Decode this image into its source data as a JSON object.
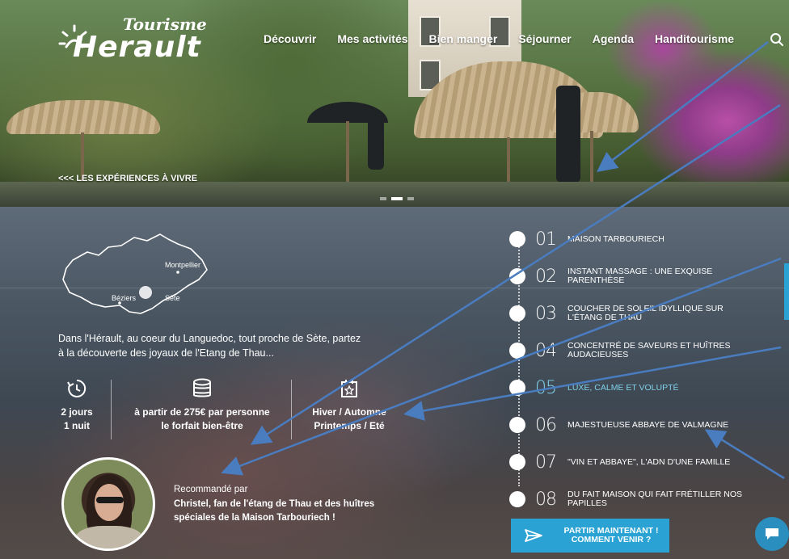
{
  "logo": {
    "line1": "Tourisme",
    "line2": "Herault"
  },
  "nav": {
    "items": [
      "Découvrir",
      "Mes activités",
      "Bien manger",
      "Séjourner",
      "Agenda",
      "Handitourisme"
    ]
  },
  "hero": {
    "back_link": "<<< LES EXPÉRIENCES À VIVRE"
  },
  "map": {
    "cities": [
      "Montpellier",
      "Béziers",
      "Sète"
    ]
  },
  "intro_text": "Dans l'Hérault, au coeur du Languedoc, tout proche de Sète, partez à la découverte des joyaux de l'Etang de Thau...",
  "facts": [
    {
      "icon": "clock-icon",
      "line1": "2 jours",
      "line2": "1 nuit"
    },
    {
      "icon": "coins-icon",
      "line1": "à partir de 275€ par personne",
      "line2": "le forfait bien-être"
    },
    {
      "icon": "calendar-star-icon",
      "line1": "Hiver / Automne",
      "line2": "Printemps / Eté"
    }
  ],
  "recommended": {
    "by_label": "Recommandé par",
    "name": "Christel, fan de l'étang de Thau et des huîtres spéciales de la Maison Tarbouriech !"
  },
  "steps": [
    {
      "num": "01",
      "label": "MAISON TARBOURIECH"
    },
    {
      "num": "02",
      "label": "INSTANT MASSAGE : UNE EXQUISE PARENTHÈSE"
    },
    {
      "num": "03",
      "label": "COUCHER DE SOLEIL IDYLLIQUE SUR L'ÉTANG DE THAU"
    },
    {
      "num": "04",
      "label": "CONCENTRÉ DE SAVEURS ET HUÎTRES AUDACIEUSES"
    },
    {
      "num": "05",
      "label": "LUXE, CALME ET VOLUPTÉ"
    },
    {
      "num": "06",
      "label": "MAJESTUEUSE ABBAYE DE VALMAGNE"
    },
    {
      "num": "07",
      "label": "\"VIN ET ABBAYE\", L'ADN D'UNE FAMILLE"
    },
    {
      "num": "08",
      "label": "DU FAIT MAISON QUI FAIT FRÉTILLER NOS PAPILLES"
    }
  ],
  "active_step": 4,
  "cta": {
    "label": "PARTIR MAINTENANT ! COMMENT VENIR ?"
  },
  "colors": {
    "accent": "#2aa3d4",
    "active_step": "#7fd0e8",
    "annotation_arrow": "#4a7cc0"
  }
}
